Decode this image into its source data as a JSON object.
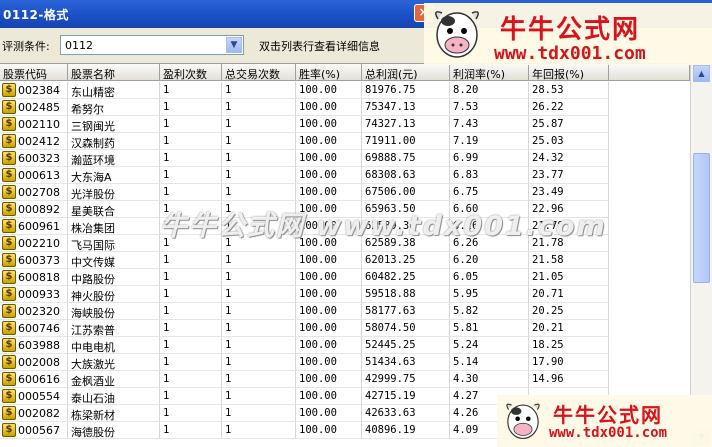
{
  "window": {
    "title": "0112-格式",
    "close_label": "×"
  },
  "criteria": {
    "label": "评测条件:",
    "value": "0112",
    "hint": "双击列表行查看详细信息"
  },
  "columns": [
    "股票代码",
    "股票名称",
    "盈利次数",
    "总交易次数",
    "胜率(%)",
    "总利润(元)",
    "利润率(%)",
    "年回报(%)"
  ],
  "rows": [
    [
      "002384",
      "东山精密",
      "1",
      "1",
      "100.00",
      "81976.75",
      "8.20",
      "28.53"
    ],
    [
      "002485",
      "希努尔",
      "1",
      "1",
      "100.00",
      "75347.13",
      "7.53",
      "26.22"
    ],
    [
      "002110",
      "三钢闽光",
      "1",
      "1",
      "100.00",
      "74327.13",
      "7.43",
      "25.87"
    ],
    [
      "002412",
      "汉森制药",
      "1",
      "1",
      "100.00",
      "71911.00",
      "7.19",
      "25.03"
    ],
    [
      "600323",
      "瀚蓝环境",
      "1",
      "1",
      "100.00",
      "69888.75",
      "6.99",
      "24.32"
    ],
    [
      "000613",
      "大东海A",
      "1",
      "1",
      "100.00",
      "68308.63",
      "6.83",
      "23.77"
    ],
    [
      "002708",
      "光洋股份",
      "1",
      "1",
      "100.00",
      "67506.00",
      "6.75",
      "23.49"
    ],
    [
      "000892",
      "星美联合",
      "1",
      "1",
      "100.00",
      "65963.50",
      "6.60",
      "22.96"
    ],
    [
      "600961",
      "株冶集团",
      "1",
      "1",
      "100.00",
      "62589.38",
      "6.26",
      "21.78"
    ],
    [
      "002210",
      "飞马国际",
      "1",
      "1",
      "100.00",
      "62589.38",
      "6.26",
      "21.78"
    ],
    [
      "600373",
      "中文传媒",
      "1",
      "1",
      "100.00",
      "62013.25",
      "6.20",
      "21.58"
    ],
    [
      "600818",
      "中路股份",
      "1",
      "1",
      "100.00",
      "60482.25",
      "6.05",
      "21.05"
    ],
    [
      "000933",
      "神火股份",
      "1",
      "1",
      "100.00",
      "59518.88",
      "5.95",
      "20.71"
    ],
    [
      "002320",
      "海峡股份",
      "1",
      "1",
      "100.00",
      "58177.63",
      "5.82",
      "20.25"
    ],
    [
      "600746",
      "江苏索普",
      "1",
      "1",
      "100.00",
      "58074.50",
      "5.81",
      "20.21"
    ],
    [
      "603988",
      "中电电机",
      "1",
      "1",
      "100.00",
      "52445.25",
      "5.24",
      "18.25"
    ],
    [
      "002008",
      "大族激光",
      "1",
      "1",
      "100.00",
      "51434.63",
      "5.14",
      "17.90"
    ],
    [
      "600616",
      "金枫酒业",
      "1",
      "1",
      "100.00",
      "42999.75",
      "4.30",
      "14.96"
    ],
    [
      "000554",
      "泰山石油",
      "1",
      "1",
      "100.00",
      "42715.19",
      "4.27",
      ""
    ],
    [
      "002082",
      "栋梁新材",
      "1",
      "1",
      "100.00",
      "42633.63",
      "4.26",
      ""
    ],
    [
      "000567",
      "海德股份",
      "1",
      "1",
      "100.00",
      "40896.19",
      "4.09",
      ""
    ]
  ],
  "logo": {
    "cn": "牛牛公式网",
    "url": "www.tdx001.com"
  },
  "watermark": "牛牛公式网 www.tdx001.com",
  "icons": {
    "stock": "dollar-icon",
    "dropdown": "chevron-down-icon",
    "cow": "cow-icon"
  }
}
